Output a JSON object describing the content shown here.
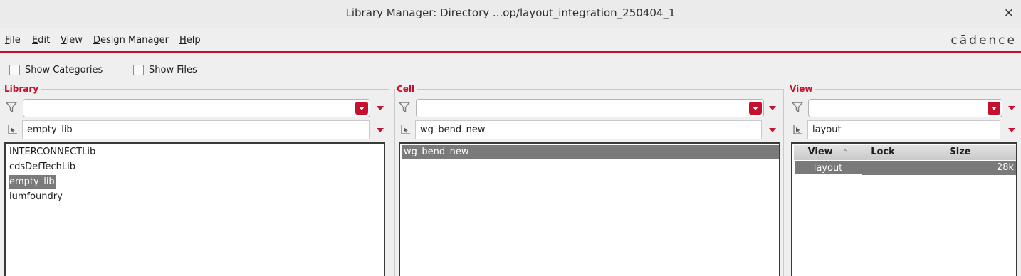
{
  "window": {
    "title": "Library Manager: Directory ...op/layout_integration_250404_1",
    "close_glyph": "×"
  },
  "menu": [
    {
      "underline": "F",
      "rest": "ile"
    },
    {
      "underline": "E",
      "rest": "dit"
    },
    {
      "underline": "V",
      "rest": "iew"
    },
    {
      "underline": "D",
      "rest": "esign Manager"
    },
    {
      "underline": "H",
      "rest": "elp"
    }
  ],
  "brand": "cādence",
  "options": {
    "show_categories": "Show Categories",
    "show_files": "Show Files"
  },
  "library": {
    "label": "Library",
    "filter_value": "",
    "selected": "empty_lib",
    "items": [
      "INTERCONNECTLib",
      "cdsDefTechLib",
      "empty_lib",
      "lumfoundry"
    ],
    "selected_index": 2
  },
  "cell": {
    "label": "Cell",
    "filter_value": "",
    "selected": "wg_bend_new",
    "items": [
      "wg_bend_new"
    ],
    "selected_index": 0
  },
  "view": {
    "label": "View",
    "filter_value": "",
    "selected": "layout",
    "columns": [
      "View",
      "Lock",
      "Size"
    ],
    "sort_indicator": "^",
    "rows": [
      {
        "view": "layout",
        "lock": "",
        "size": "28k"
      }
    ]
  },
  "icons": {
    "filter": "funnel-icon",
    "selection": "cursor-select-icon",
    "dropdown": "red-dropdown-arrow-icon"
  },
  "colors": {
    "accent": "#c8102e",
    "selection": "#7a7a7a",
    "background": "#efefef"
  }
}
